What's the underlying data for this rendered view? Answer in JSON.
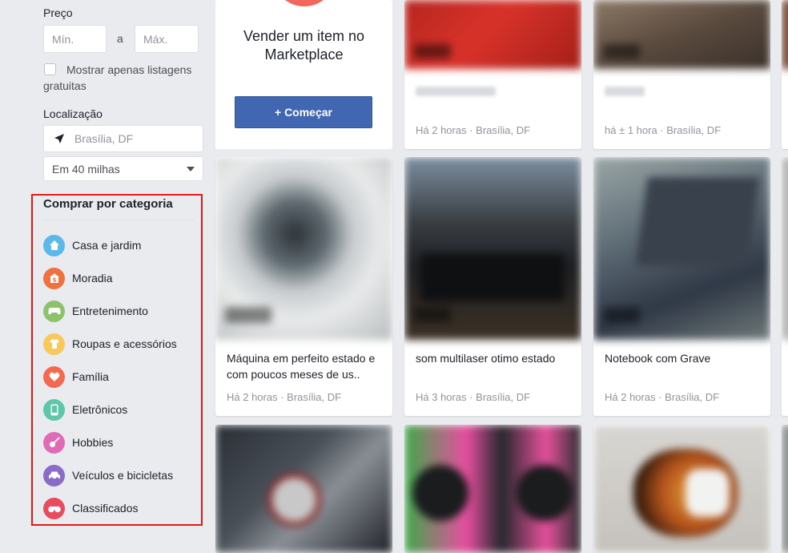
{
  "filters": {
    "price_label": "Preço",
    "min_placeholder": "Mín.",
    "max_placeholder": "Máx.",
    "range_separator": "a",
    "free_only_label": "Mostrar apenas listagens gratuitas",
    "location_label": "Localização",
    "location_value": "Brasília, DF",
    "radius_value": "Em 40 milhas"
  },
  "categories": {
    "title": "Comprar por categoria",
    "items": [
      {
        "label": "Casa e jardim",
        "icon": "house-icon",
        "color": "#5bb8e8"
      },
      {
        "label": "Moradia",
        "icon": "home-dollar-icon",
        "color": "#f0703e"
      },
      {
        "label": "Entretenimento",
        "icon": "gamepad-icon",
        "color": "#8dc26b"
      },
      {
        "label": "Roupas e acessórios",
        "icon": "shirt-icon",
        "color": "#f7c85a"
      },
      {
        "label": "Família",
        "icon": "heart-icon",
        "color": "#f26b50"
      },
      {
        "label": "Eletrônicos",
        "icon": "phone-icon",
        "color": "#5cc8a7"
      },
      {
        "label": "Hobbies",
        "icon": "guitar-icon",
        "color": "#e06ab6"
      },
      {
        "label": "Veículos e bicicletas",
        "icon": "car-icon",
        "color": "#8b6bc8"
      },
      {
        "label": "Classificados",
        "icon": "binoculars-icon",
        "color": "#e84a5f"
      }
    ]
  },
  "sell": {
    "text": "Vender um item no Marketplace",
    "button_label": "+ Começar"
  },
  "listings": [
    {
      "meta": "Há 2 horas · Brasília, DF"
    },
    {
      "meta": "há ± 1 hora · Brasília, DF"
    },
    {
      "title": "Máquina em perfeito estado e com poucos meses de us..",
      "meta": "Há 2 horas · Brasília, DF"
    },
    {
      "title": "som multilaser otimo estado",
      "meta": "Há 3 horas · Brasília, DF"
    },
    {
      "title": "Notebook com Grave",
      "meta": "Há 2 horas · Brasília, DF"
    }
  ]
}
